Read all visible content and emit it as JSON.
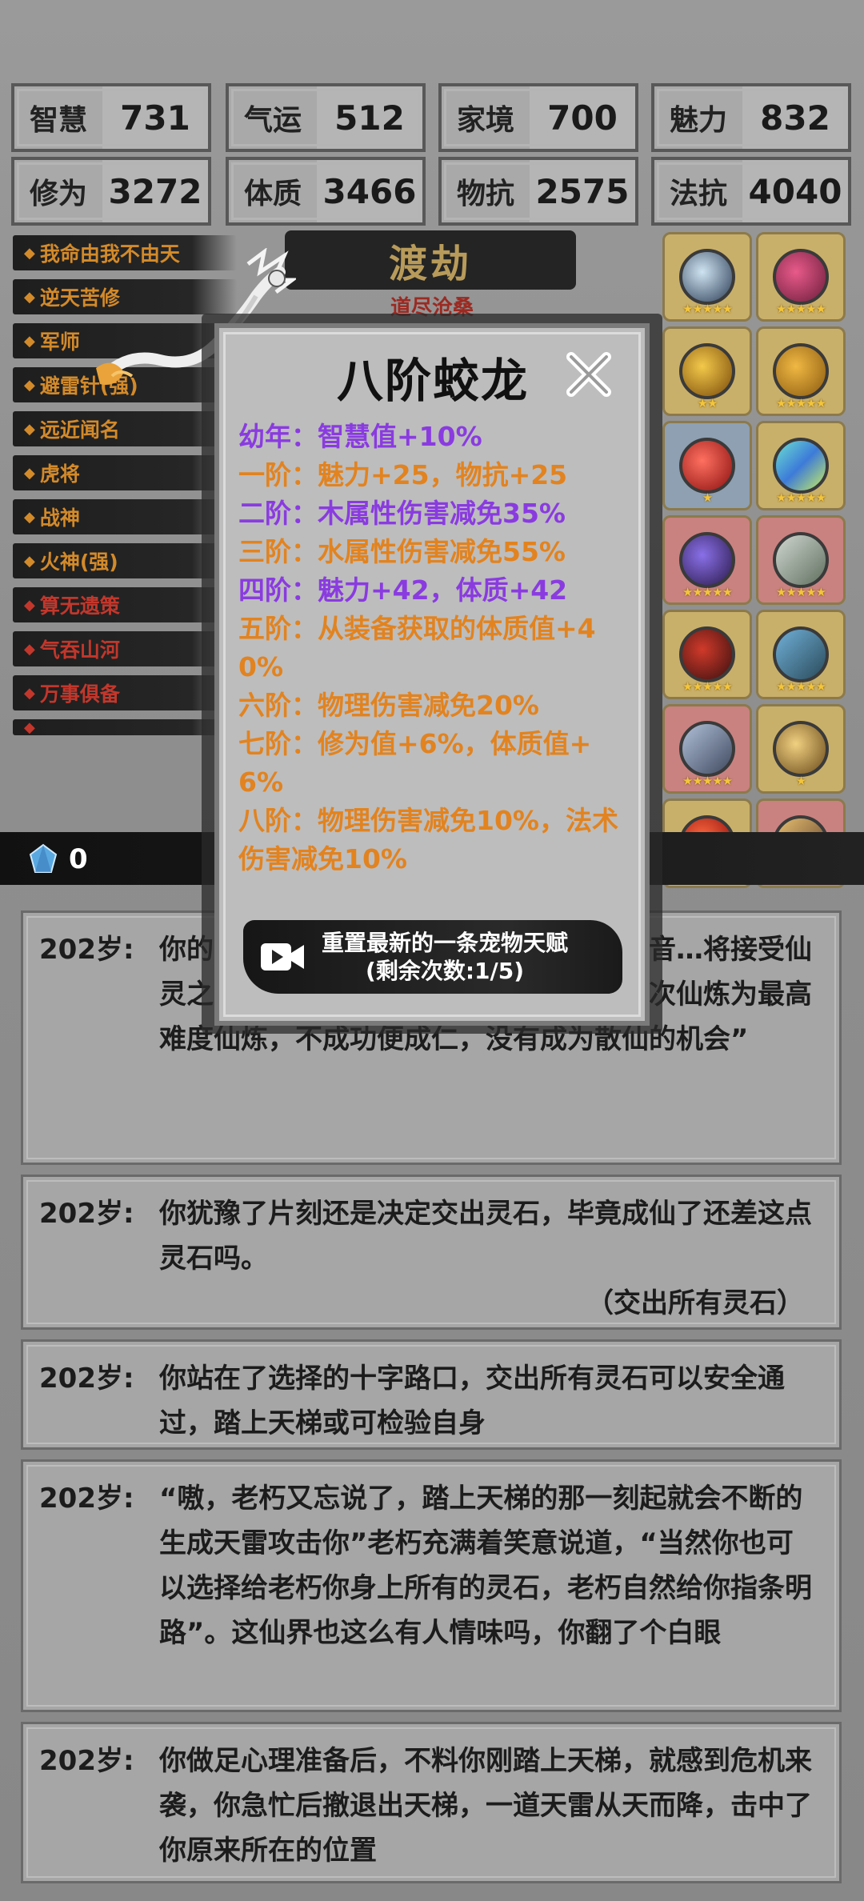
{
  "stats": [
    {
      "label": "智慧",
      "value": "731"
    },
    {
      "label": "气运",
      "value": "512"
    },
    {
      "label": "家境",
      "value": "700"
    },
    {
      "label": "魅力",
      "value": "832"
    },
    {
      "label": "修为",
      "value": "3272"
    },
    {
      "label": "体质",
      "value": "3466"
    },
    {
      "label": "物抗",
      "value": "2575"
    },
    {
      "label": "法抗",
      "value": "4040"
    }
  ],
  "talents": [
    {
      "label": "我命由我不由天",
      "color": "orange"
    },
    {
      "label": "逆天苦修",
      "color": "orange"
    },
    {
      "label": "军师",
      "color": "orange"
    },
    {
      "label": "避雷针(强)",
      "color": "orange"
    },
    {
      "label": "远近闻名",
      "color": "orange"
    },
    {
      "label": "虎将",
      "color": "orange"
    },
    {
      "label": "战神",
      "color": "orange"
    },
    {
      "label": "火神(强)",
      "color": "orange"
    },
    {
      "label": "算无遗策",
      "color": "red"
    },
    {
      "label": "气吞山河",
      "color": "red"
    },
    {
      "label": "万事俱备",
      "color": "red"
    }
  ],
  "header": {
    "title": "渡劫",
    "subtitle": "道尽沧桑"
  },
  "equipment": [
    {
      "icon": "orb-icon",
      "bg": "gold",
      "stars": 5
    },
    {
      "icon": "serpent-icon",
      "bg": "gold",
      "stars": 5
    },
    {
      "icon": "ring-icon",
      "bg": "gold",
      "stars": 2
    },
    {
      "icon": "leaf-icon",
      "bg": "gold",
      "stars": 5
    },
    {
      "icon": "red-orb-icon",
      "bg": "blue",
      "stars": 1
    },
    {
      "icon": "crystal-icon",
      "bg": "gold",
      "stars": 5
    },
    {
      "icon": "mirror-icon",
      "bg": "red",
      "stars": 5
    },
    {
      "icon": "halberd-icon",
      "bg": "red",
      "stars": 5
    },
    {
      "icon": "dragon-ring-icon",
      "bg": "gold",
      "stars": 5
    },
    {
      "icon": "sword-hilt-icon",
      "bg": "gold",
      "stars": 5
    },
    {
      "icon": "spear-icon",
      "bg": "red",
      "stars": 5
    },
    {
      "icon": "fan-icon",
      "bg": "gold",
      "stars": 1
    },
    {
      "icon": "fire-pearl-icon",
      "bg": "gold",
      "stars": 5
    },
    {
      "icon": "blade-icon",
      "bg": "red",
      "stars": 4
    }
  ],
  "gem_count": "0",
  "modal": {
    "title": "八阶蛟龙",
    "lines": [
      {
        "text": "幼年：智慧值+10%",
        "color": "purple"
      },
      {
        "text": "一阶：魅力+25，物抗+25",
        "color": "orange"
      },
      {
        "text": "二阶：木属性伤害减免35%",
        "color": "purple"
      },
      {
        "text": "三阶：水属性伤害减免55%",
        "color": "orange"
      },
      {
        "text": "四阶：魅力+42，体质+42",
        "color": "purple"
      },
      {
        "text": "五阶：从装备获取的体质值+40%",
        "color": "orange"
      },
      {
        "text": "六阶：物理伤害减免20%",
        "color": "orange"
      },
      {
        "text": "七阶：修为值+6%，体质值+6%",
        "color": "orange"
      },
      {
        "text": "八阶：物理伤害减免10%，法术伤害减免10%",
        "color": "orange"
      }
    ],
    "reset_line1": "重置最新的一条宠物天赋",
    "reset_line2": "(剩余次数:1/5)"
  },
  "logs": [
    {
      "age": "202岁:",
      "text": "你的（部分被弹窗遮挡）突然传来一道声音…将接受仙灵之息的洗炼，以涤荡凡胎化仙，由于本次仙炼为最高难度仙炼，不成功便成仁，没有成为散仙的机会”",
      "choice": ""
    },
    {
      "age": "202岁:",
      "text": "你犹豫了片刻还是决定交出灵石，毕竟成仙了还差这点灵石吗。",
      "choice": "（交出所有灵石）"
    },
    {
      "age": "202岁:",
      "text": "你站在了选择的十字路口，交出所有灵石可以安全通过，踏上天梯或可检验自身",
      "choice": ""
    },
    {
      "age": "202岁:",
      "text": "“嗷，老朽又忘说了，踏上天梯的那一刻起就会不断的生成天雷攻击你”老朽充满着笑意说道，“当然你也可以选择给老朽你身上所有的灵石，老朽自然给你指条明路”。这仙界也这么有人情味吗，你翻了个白眼",
      "choice": ""
    },
    {
      "age": "202岁:",
      "text": "你做足心理准备后，不料你刚踏上天梯，就感到危机来袭，你急忙后撤退出天梯，一道天雷从天而降，击中了你原来所在的位置",
      "choice": ""
    }
  ]
}
